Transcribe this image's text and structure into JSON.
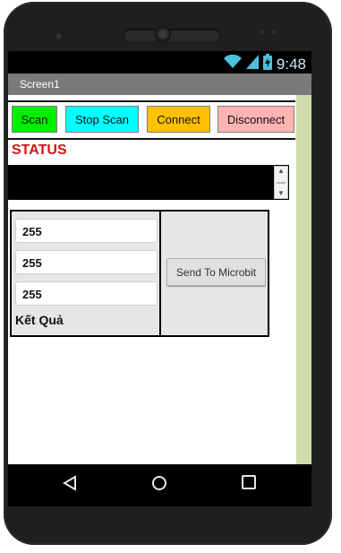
{
  "device": {
    "time": "9:48",
    "icons": [
      "wifi-icon",
      "signal-icon",
      "battery-icon"
    ]
  },
  "app": {
    "screen_title": "Screen1"
  },
  "buttons": {
    "scan": "Scan",
    "stop_scan": "Stop Scan",
    "connect": "Connect",
    "disconnect": "Disconnect"
  },
  "button_colors": {
    "scan": "#00ee00",
    "stop_scan": "#00ffff",
    "connect": "#ffc000",
    "disconnect": "#ffb3b3"
  },
  "status": {
    "label": "STATUS",
    "label_color": "#d11515",
    "text": ""
  },
  "inputs": {
    "red": "255",
    "green": "255",
    "blue": "255"
  },
  "result_label": "Kết Quả",
  "send_button": "Send To Microbit",
  "navigation": [
    "back-icon",
    "home-icon",
    "recents-icon"
  ]
}
